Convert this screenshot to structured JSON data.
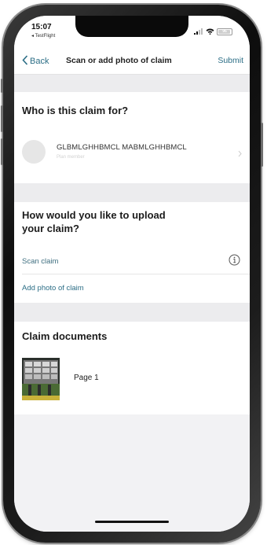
{
  "status_bar": {
    "time": "15:07",
    "testflight": "◂ TestFlight",
    "battery": "96"
  },
  "nav": {
    "back_label": "Back",
    "title": "Scan or add photo of claim",
    "submit_label": "Submit"
  },
  "claim_for": {
    "heading": "Who is this claim for?",
    "member_name": "GLBMLGHHBMCL MABMLGHHBMCL",
    "member_sub": "Plan member"
  },
  "upload": {
    "heading_line1": "How would you like to upload",
    "heading_line2": "your claim?",
    "scan_label": "Scan claim",
    "add_photo_label": "Add photo of claim"
  },
  "documents": {
    "heading": "Claim documents",
    "items": [
      {
        "label": "Page 1"
      }
    ]
  },
  "colors": {
    "link": "#2c6e86",
    "scan_text": "#3f6f80",
    "band": "#ececee"
  }
}
